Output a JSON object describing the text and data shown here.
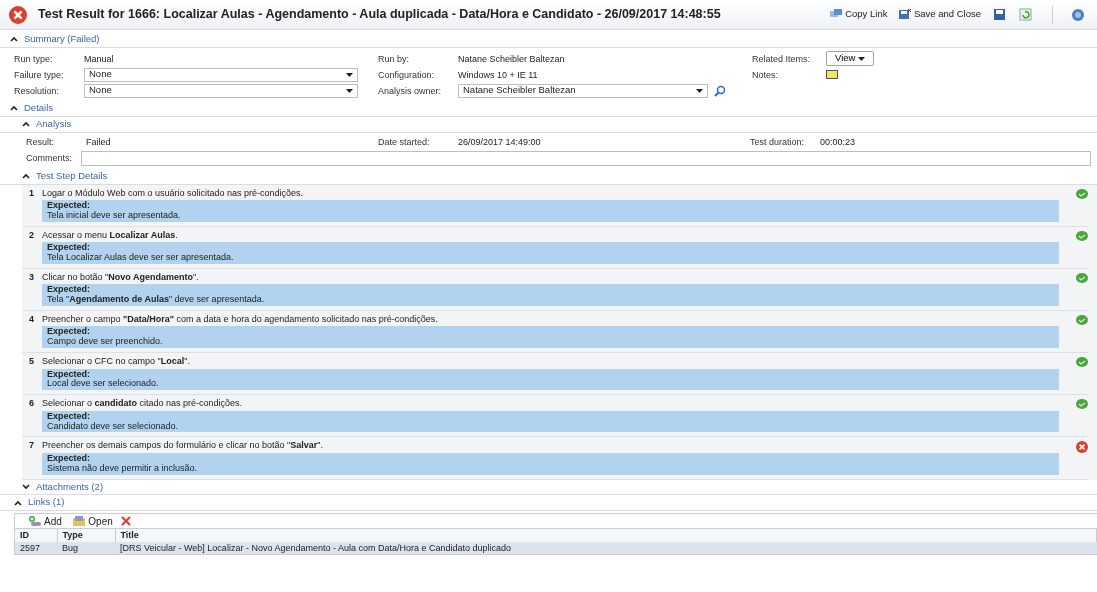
{
  "window": {
    "title": "Test Result for 1666: Localizar Aulas - Agendamento - Aula duplicada - Data/Hora e Candidato - 26/09/2017 14:48:55",
    "failed": true
  },
  "toolbar": [
    {
      "kind": "copy",
      "label": "Copy Link"
    },
    {
      "kind": "save-close",
      "label": "Save and Close"
    },
    {
      "kind": "save"
    },
    {
      "kind": "refresh"
    },
    {
      "kind": "help"
    }
  ],
  "summary": {
    "header": "Summary (Failed)",
    "expanded": true,
    "columns": [
      [
        {
          "label": "Run type:",
          "kind": "text",
          "value": "Manual"
        },
        {
          "label": "Failure type:",
          "kind": "select",
          "value": "None"
        },
        {
          "label": "Resolution:",
          "kind": "select",
          "value": "None"
        }
      ],
      [
        {
          "label": "Run by:",
          "kind": "text",
          "value": "Natane Scheibler Baltezan"
        },
        {
          "label": "Configuration:",
          "kind": "text",
          "value": "Windows 10 + IE 11"
        },
        {
          "label": "Analysis owner:",
          "kind": "select-search",
          "value": "Natane Scheibler Baltezan"
        }
      ],
      [
        {
          "label": "Related Items:",
          "kind": "button",
          "value": "View"
        },
        {
          "label": "Notes:",
          "kind": "notes"
        }
      ]
    ]
  },
  "details": {
    "header": "Details",
    "expanded": true,
    "analysis": {
      "header": "Analysis",
      "expanded": true,
      "fields": [
        {
          "label": "Result:",
          "value": "Failed"
        },
        {
          "label": "Date started:",
          "value": "26/09/2017 14:49:00"
        },
        {
          "label": "Test duration:",
          "value": "00:00:23"
        }
      ],
      "comments": {
        "label": "Comments:"
      }
    },
    "test_steps": {
      "header": "Test Step Details",
      "expanded": true,
      "steps": [
        {
          "number": "1",
          "action": "Logar o Módulo Web com o usuário solicitado nas pré-condições.",
          "expected_label": "Expected:",
          "expected": "Tela inicial deve ser apresentada.",
          "passed": true
        },
        {
          "number": "2",
          "action": "Acessar o menu **Localizar Aulas**.",
          "expected_label": "Expected:",
          "expected": "Tela Localizar Aulas deve ser ser apresentada.",
          "passed": true
        },
        {
          "number": "3",
          "action": "Clicar no botão \"**Novo Agendamento**\".",
          "expected_label": "Expected:",
          "expected": "Tela \"**Agendamento de Aulas**\" deve ser apresentada.",
          "passed": true
        },
        {
          "number": "4",
          "action": "Preencher o campo **\"Data/Hora\"** com a data e hora do agendamento solicitado nas pré-condições.",
          "expected_label": "Expected:",
          "expected": "Campo deve ser preenchido.",
          "passed": true
        },
        {
          "number": "5",
          "action": "Selecionar o CFC no campo \"**Local**\".",
          "expected_label": "Expected:",
          "expected": "Local deve ser selecionado.",
          "passed": true
        },
        {
          "number": "6",
          "action": "Selecionar o **candidato** citado nas pré-condições.",
          "expected_label": "Expected:",
          "expected": "Candidato deve ser selecionado.",
          "passed": true
        },
        {
          "number": "7",
          "action": "Preencher os demais campos do formulário e clicar no botão \"**Salvar**\".",
          "expected_label": "Expected:",
          "expected": "Sistema não deve permitir a inclusão.",
          "passed": false
        }
      ]
    },
    "attachments": {
      "header": "Attachments (2)",
      "expanded": false
    }
  },
  "links": {
    "header": "Links (1)",
    "expanded": true,
    "actions": [
      {
        "kind": "add",
        "label": "Add"
      },
      {
        "kind": "open",
        "label": "Open"
      },
      {
        "kind": "delete"
      }
    ],
    "table": {
      "columns": [
        "ID",
        "Type",
        "Title"
      ],
      "rows": [
        [
          "2597",
          "Bug",
          "[DRS Veicular - Web] Localizar - Novo Agendamento - Aula com Data/Hora e Candidato duplicado"
        ]
      ]
    }
  }
}
